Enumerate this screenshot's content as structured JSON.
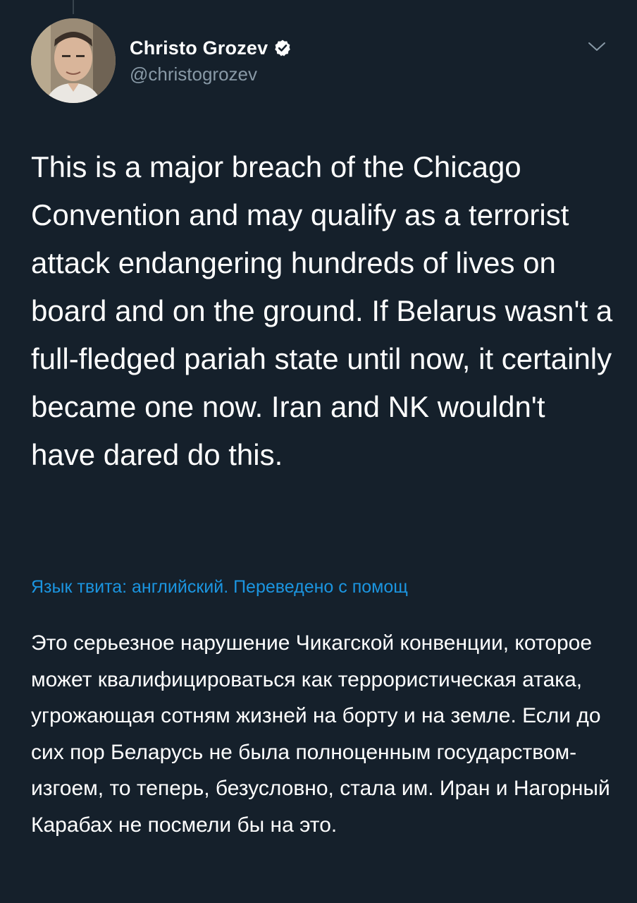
{
  "author": {
    "display_name": "Christo Grozev",
    "handle": "@christogrozev",
    "verified": true
  },
  "icons": {
    "verified": "verified-badge-icon",
    "menu": "chevron-down-icon"
  },
  "colors": {
    "background": "#15202b",
    "text_primary": "#ffffff",
    "text_secondary": "#8899a6",
    "link": "#1b95e0"
  },
  "tweet": {
    "text": "This is a major breach of the Chicago Convention and may qualify as a terrorist attack endangering hundreds of lives on board and on the ground. If Belarus wasn't a full-fledged pariah state until now, it certainly became one now. Iran and NK wouldn't have dared do this."
  },
  "translation": {
    "notice": "Язык твита: английский. Переведено с помощ",
    "text": "Это серьезное нарушение Чикагской конвенции, которое может квалифицироваться как террористическая атака, угрожающая сотням жизней на борту и на земле. Если до сих пор Беларусь не была полноценным государством-изгоем, то теперь, безусловно, стала им. Иран и Нагорный Карабах не посмели бы на это."
  }
}
